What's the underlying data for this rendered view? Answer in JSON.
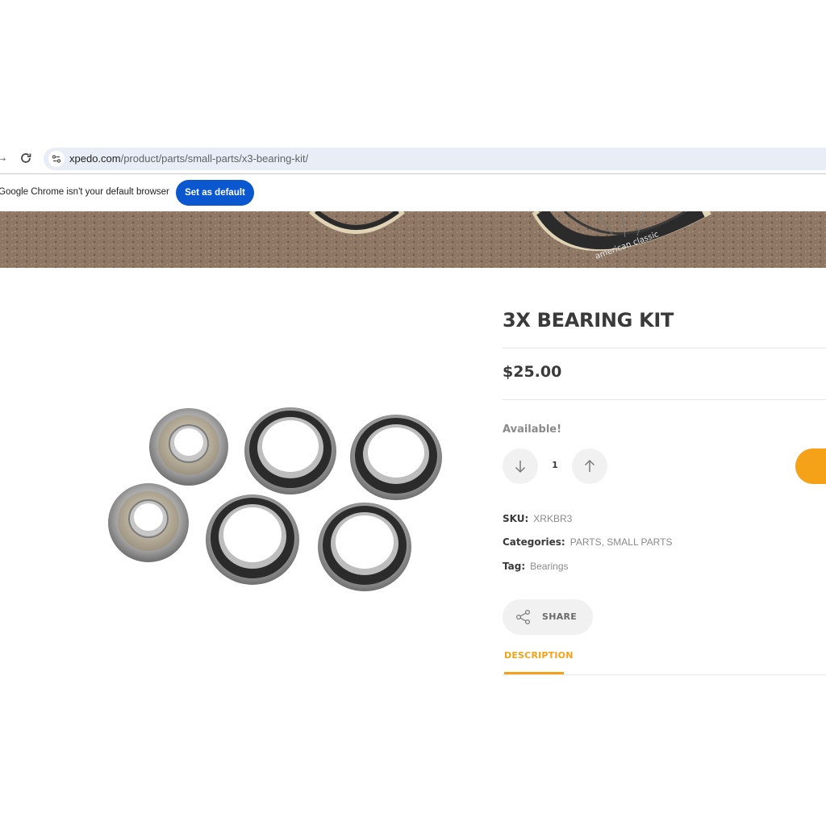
{
  "browser": {
    "url_host": "xpedo.com",
    "url_path": "/product/parts/small-parts/x3-bearing-kit/",
    "infobar_message": "Google Chrome isn't your default browser",
    "set_default_label": "Set as default"
  },
  "hero": {
    "tire_brand_text": "american classic"
  },
  "product": {
    "title": "3X BEARING KIT",
    "price": "$25.00",
    "availability": "Available!",
    "quantity": "1",
    "meta": {
      "sku_label": "SKU:",
      "sku_value": "XRKBR3",
      "categories_label": "Categories:",
      "categories_value": "PARTS, SMALL PARTS",
      "tag_label": "Tag:",
      "tag_value": "Bearings"
    },
    "share_label": "SHARE",
    "tabs": [
      {
        "label": "DESCRIPTION",
        "active": true
      }
    ]
  },
  "colors": {
    "accent": "#f5a219",
    "chrome_blue": "#0b57d0",
    "omnibox_bg": "#e9eef6"
  },
  "icons": {
    "forward": "arrow-right-icon",
    "reload": "reload-icon",
    "site_info": "tune-icon",
    "qty_down": "arrow-down-icon",
    "qty_up": "arrow-up-icon",
    "cart": "cart-icon",
    "share": "share-icon"
  }
}
